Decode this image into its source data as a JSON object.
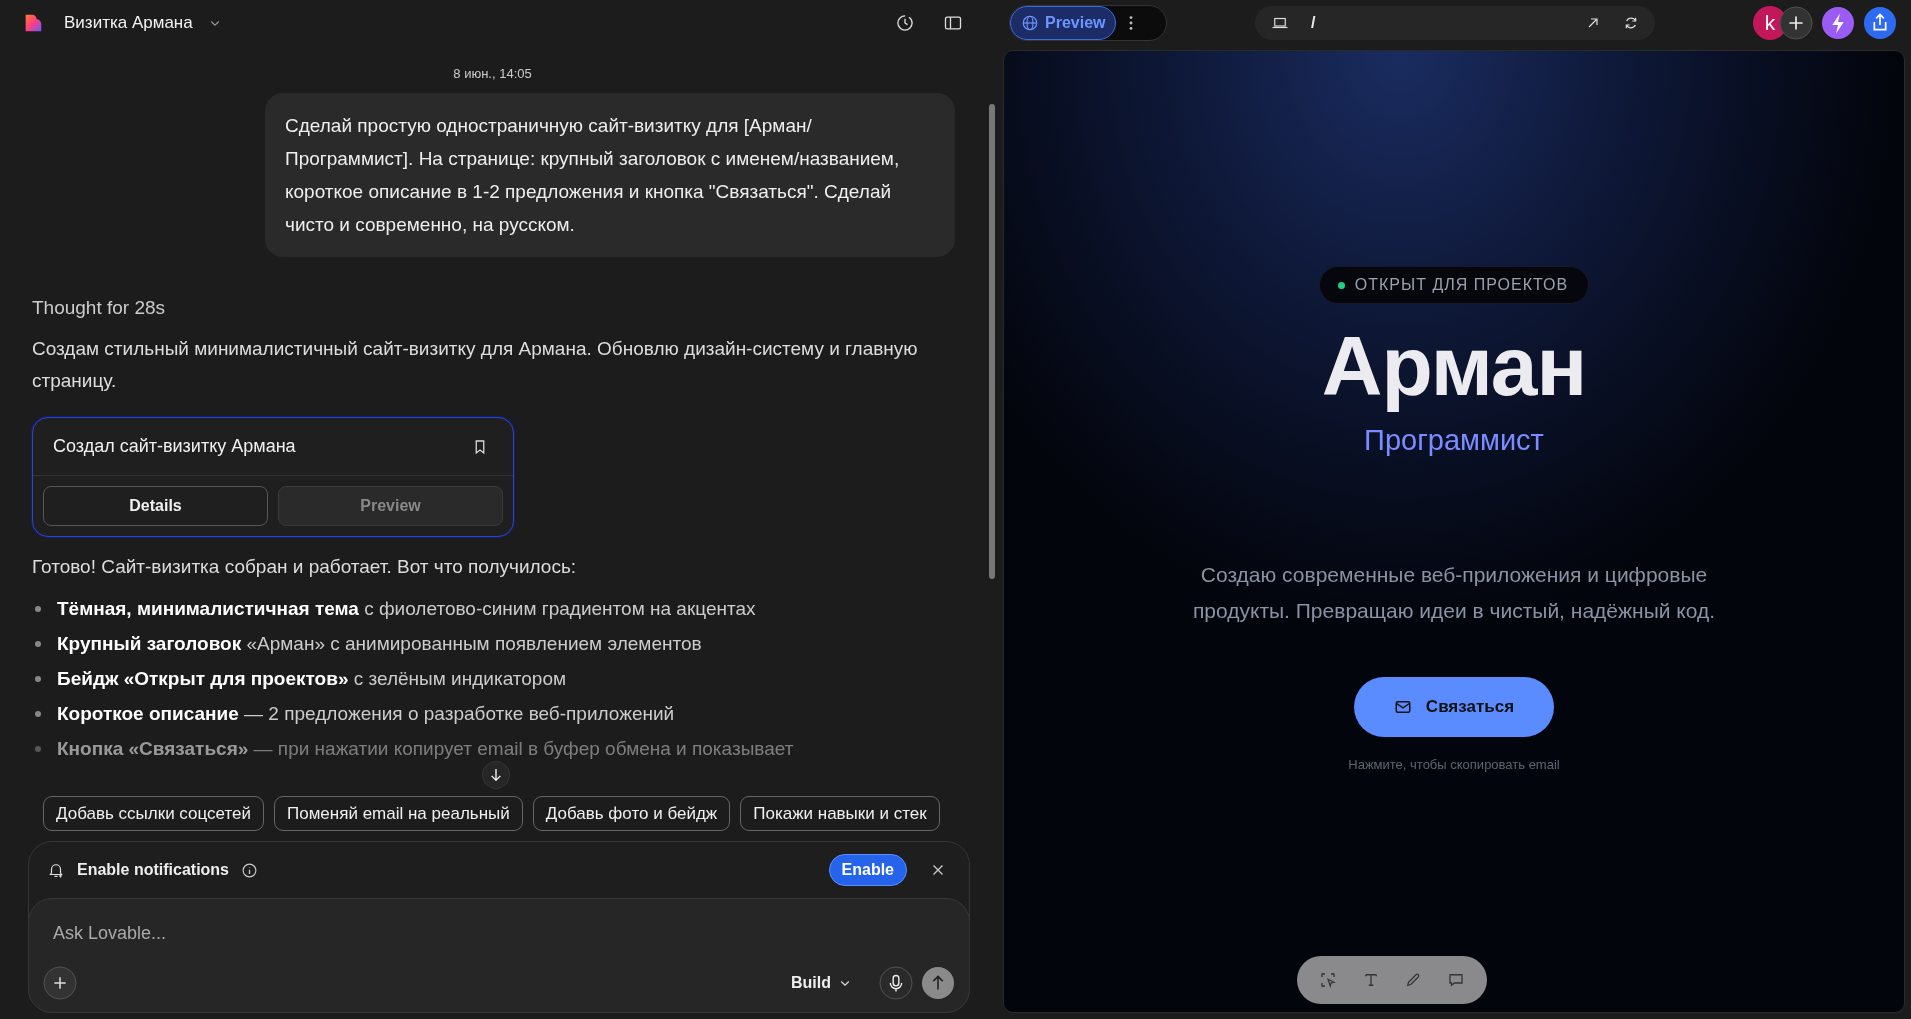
{
  "app": {
    "project_name": "Визитка Армана"
  },
  "toolbar": {
    "preview_tab": {
      "label": "Preview",
      "selected": true
    },
    "url_path": "/",
    "avatar_letter": "k"
  },
  "chat": {
    "timestamp": "8 июн., 14:05",
    "user_message": "Сделай простую одностраничную сайт-визитку для [Арман/Программист]. На странице: крупный заголовок с именем/названием, короткое описание в 1-2 предложения и кнопка \"Связаться\". Сделай чисто и современно, на русском.",
    "thought": "Thought for 28s",
    "intro": "Создам стильный минималистичный сайт-визитку для Армана. Обновлю дизайн-систему и главную страницу.",
    "card": {
      "title": "Создал сайт-визитку Армана",
      "buttons": [
        {
          "label": "Details",
          "disabled": false
        },
        {
          "label": "Preview",
          "disabled": true
        }
      ]
    },
    "summary": "Готово! Сайт-визитка собран и работает. Вот что получилось:",
    "bullets": [
      {
        "text": "**Тёмная, минималистичная тема** с фиолетово-синим градиентом на акцентах",
        "faded": false
      },
      {
        "text": "**Крупный заголовок** «Арман» с анимированным появлением элементов",
        "faded": false
      },
      {
        "text": "**Бейдж «Открыт для проектов»** с зелёным индикатором",
        "faded": false
      },
      {
        "text": "**Короткое описание** — 2 предложения о разработке веб-приложений",
        "faded": false
      },
      {
        "text": "**Кнопка «Связаться»** — при нажатии копирует email в буфер обмена и показывает",
        "faded": true
      }
    ]
  },
  "suggestions": [
    "Добавь ссылки соцсетей",
    "Поменяй email на реальный",
    "Добавь фото и бейдж",
    "Покажи навыки и стек"
  ],
  "notification": {
    "label": "Enable notifications",
    "button": "Enable"
  },
  "composer": {
    "placeholder": "Ask Lovable...",
    "mode": "Build"
  },
  "preview": {
    "badge": "ОТКРЫТ ДЛЯ ПРОЕКТОВ",
    "name": "Арман",
    "role": "Программист",
    "description": "Создаю современные веб-приложения и цифровые продукты. Превращаю идеи в чистый, надёжный код.",
    "button": "Связаться",
    "hint": "Нажмите, чтобы скопировать email"
  }
}
